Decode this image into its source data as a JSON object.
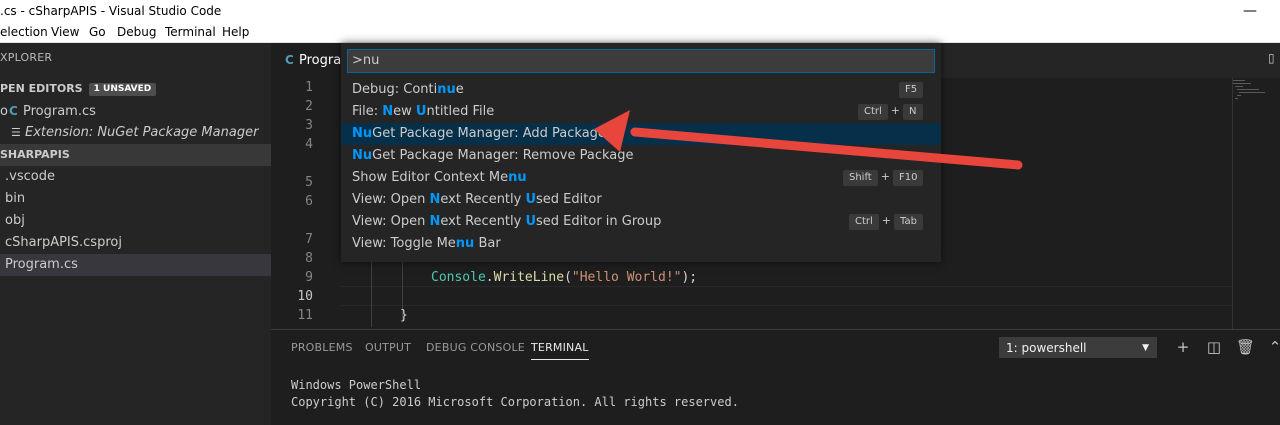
{
  "window": {
    "title": ".cs - cSharpAPIS - Visual Studio Code",
    "minimize_glyph": "—"
  },
  "menu": [
    "election",
    "View",
    "Go",
    "Debug",
    "Terminal",
    "Help"
  ],
  "sidebar": {
    "title": "XPLORER",
    "open_editors": {
      "label": "PEN EDITORS",
      "badge": "1 UNSAVED"
    },
    "open_items": [
      {
        "icon": "csharp-file-icon",
        "glyph": "C",
        "label": "Program.cs"
      },
      {
        "icon": "extension-page-icon",
        "glyph": "☰",
        "label": "Extension: NuGet Package Manager"
      }
    ],
    "project": "SHARPAPIS",
    "files": [
      ".vscode",
      "bin",
      "obj",
      "cSharpAPIS.csproj",
      "Program.cs"
    ]
  },
  "editor": {
    "tab": {
      "icon": "csharp-file-icon",
      "glyph": "C",
      "label": "Progra"
    },
    "line_numbers": [
      "1",
      "2",
      "3",
      "4",
      "5",
      "6",
      "7",
      "8",
      "9",
      "10",
      "11"
    ],
    "code_line9": {
      "cls": "Console",
      "dot": ".",
      "fn": "WriteLine",
      "open": "(",
      "str": "\"Hello World!\"",
      "close": ");"
    },
    "code_line11": "}"
  },
  "quickpick": {
    "input": ">nu",
    "items": [
      {
        "parts": [
          [
            "Debug: Conti",
            false
          ],
          [
            "nu",
            true
          ],
          [
            "e",
            false
          ]
        ],
        "keys": [
          "F5"
        ]
      },
      {
        "parts": [
          [
            "File: ",
            false
          ],
          [
            "N",
            true
          ],
          [
            "ew ",
            false
          ],
          [
            "U",
            true
          ],
          [
            "ntitled File",
            false
          ]
        ],
        "keys": [
          "Ctrl",
          "N"
        ]
      },
      {
        "parts": [
          [
            "Nu",
            true
          ],
          [
            "Get Package Manager: Add Package",
            false
          ]
        ],
        "keys": [],
        "selected": true
      },
      {
        "parts": [
          [
            "Nu",
            true
          ],
          [
            "Get Package Manager: Remove Package",
            false
          ]
        ],
        "keys": []
      },
      {
        "parts": [
          [
            "Show Editor Context Me",
            false
          ],
          [
            "nu",
            true
          ]
        ],
        "keys": [
          "Shift",
          "F10"
        ]
      },
      {
        "parts": [
          [
            "View: Open ",
            false
          ],
          [
            "N",
            true
          ],
          [
            "ext Recently ",
            false
          ],
          [
            "U",
            true
          ],
          [
            "sed Editor",
            false
          ]
        ],
        "keys": []
      },
      {
        "parts": [
          [
            "View: Open ",
            false
          ],
          [
            "N",
            true
          ],
          [
            "ext Recently ",
            false
          ],
          [
            "U",
            true
          ],
          [
            "sed Editor in Group",
            false
          ]
        ],
        "keys": [
          "Ctrl",
          "Tab"
        ]
      },
      {
        "parts": [
          [
            "View: Toggle Me",
            false
          ],
          [
            "nu",
            true
          ],
          [
            " Bar",
            false
          ]
        ],
        "keys": []
      }
    ],
    "key_separator": "+"
  },
  "panel": {
    "tabs": [
      "PROBLEMS",
      "OUTPUT",
      "DEBUG CONSOLE",
      "TERMINAL"
    ],
    "active_tab": "TERMINAL",
    "terminal_select": "1: powershell",
    "terminal_lines": [
      "Windows PowerShell",
      "Copyright (C) 2016 Microsoft Corporation. All rights reserved."
    ]
  },
  "colors": {
    "highlight": "#0097fb",
    "selection": "#062f4a",
    "arrow": "#e8453c"
  }
}
